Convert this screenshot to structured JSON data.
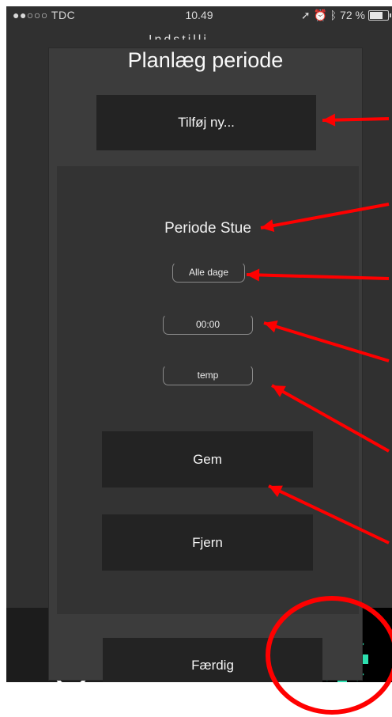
{
  "status_bar": {
    "carrier": "●●○○○ TDC ",
    "time": "10.49",
    "battery_text": "72 %",
    "battery_level": 0.72
  },
  "behind": {
    "text": "Indstilli"
  },
  "modal": {
    "title": "Planlæg periode",
    "add_button": "Tilføj ny...",
    "period_name": "Periode Stue",
    "days_value": "Alle dage",
    "time_value": "00:00",
    "temp_value": "temp",
    "save_button": "Gem",
    "remove_button": "Fjern",
    "done_button": "Færdig"
  },
  "tabbar": {
    "icons": [
      "clock-icon",
      "thermostat-icon",
      "gear-icon"
    ],
    "active_color": "#2de0b0"
  },
  "annotations": {
    "arrow_color": "#ff0000",
    "circle_color": "#ff0000"
  }
}
